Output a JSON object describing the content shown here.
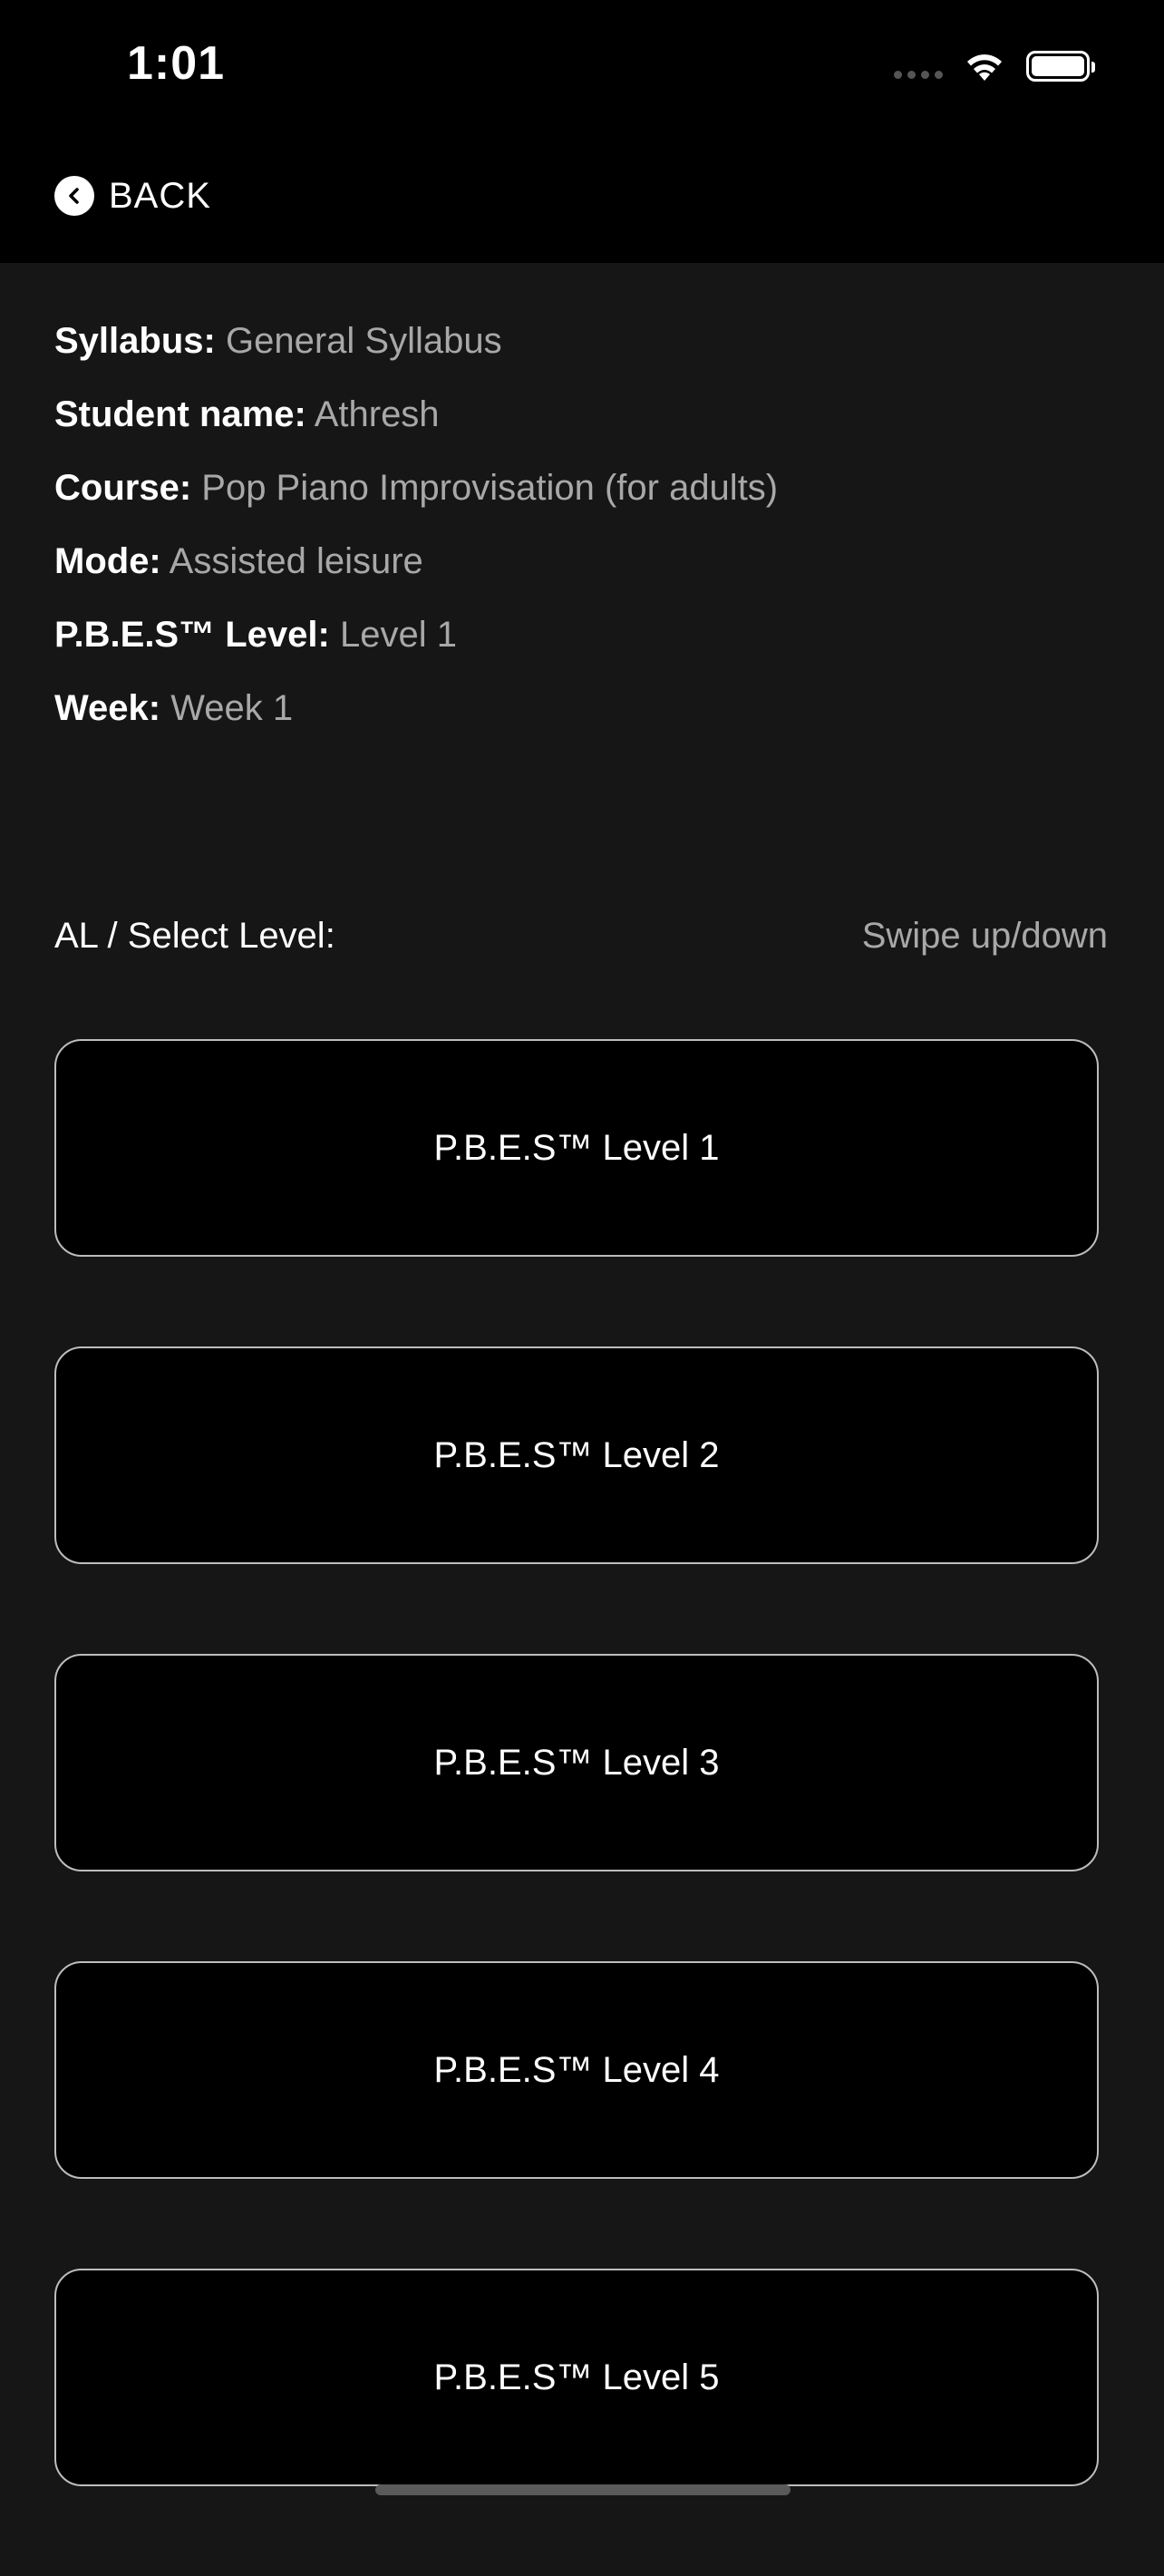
{
  "status_bar": {
    "time": "1:01"
  },
  "nav": {
    "back_label": "BACK"
  },
  "info": [
    {
      "key": "Syllabus:",
      "value": "General Syllabus"
    },
    {
      "key": "Student name:",
      "value": "Athresh"
    },
    {
      "key": "Course:",
      "value": "Pop Piano Improvisation (for adults)"
    },
    {
      "key": "Mode:",
      "value": "Assisted leisure"
    },
    {
      "key": "P.B.E.S™ Level:",
      "value": "Level 1"
    },
    {
      "key": "Week:",
      "value": "Week 1"
    }
  ],
  "select": {
    "label": "AL / Select Level:",
    "hint": "Swipe up/down"
  },
  "levels": [
    {
      "label": "P.B.E.S™ Level 1"
    },
    {
      "label": "P.B.E.S™ Level 2"
    },
    {
      "label": "P.B.E.S™ Level 3"
    },
    {
      "label": "P.B.E.S™ Level 4"
    },
    {
      "label": "P.B.E.S™ Level 5"
    }
  ],
  "colors": {
    "background": "#161616",
    "header": "#000000",
    "label": "#ffffff",
    "value": "#a8a8a8",
    "button_border": "#bdbdbd"
  },
  "icons": {
    "back": "chevron-left-circle-icon",
    "wifi": "wifi-icon",
    "battery": "battery-icon",
    "signal": "signal-icon"
  }
}
